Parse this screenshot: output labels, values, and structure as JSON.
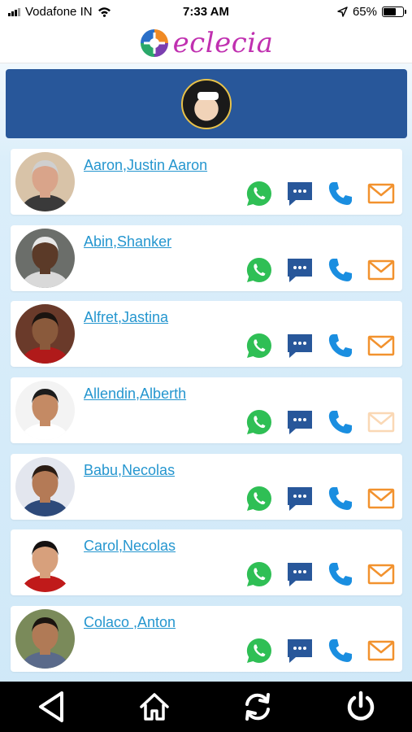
{
  "status_bar": {
    "carrier": "Vodafone IN",
    "time": "7:33 AM",
    "battery": "65%",
    "battery_level": 0.65
  },
  "app": {
    "logo_text": "eclecia",
    "brand_color": "#c030b0"
  },
  "banner": {
    "background": "#28579a"
  },
  "contacts": [
    {
      "name": "Aaron,Justin Aaron",
      "avatar_bg": "#d8c3a8",
      "skin": "#d9a48a",
      "hair": "#cfcfcf",
      "cloth": "#3a3a3a"
    },
    {
      "name": "Abin,Shanker",
      "avatar_bg": "#6b6e6a",
      "skin": "#5b3a28",
      "hair": "#e8e8e8",
      "cloth": "#d9d9d9"
    },
    {
      "name": "Alfret,Jastina",
      "avatar_bg": "#6a3a2a",
      "skin": "#8a5a3c",
      "hair": "#1b1410",
      "cloth": "#b01a1a"
    },
    {
      "name": "Allendin,Alberth",
      "avatar_bg": "#f3f3f3",
      "skin": "#c48a64",
      "hair": "#1c1c1c",
      "cloth": "#ffffff"
    },
    {
      "name": "Babu,Necolas",
      "avatar_bg": "#e3e6ee",
      "skin": "#b47a56",
      "hair": "#2a1c14",
      "cloth": "#2e4a7a"
    },
    {
      "name": "Carol,Necolas",
      "avatar_bg": "#ffffff",
      "skin": "#d7a07c",
      "hair": "#141010",
      "cloth": "#c01a1a"
    },
    {
      "name": "Colaco ,Anton",
      "avatar_bg": "#7a8a5a",
      "skin": "#b07a56",
      "hair": "#1a1410",
      "cloth": "#5a6a8a"
    }
  ],
  "actions": {
    "whatsapp_color": "#2fbf55",
    "message_color": "#28579a",
    "call_color": "#1a8ee0",
    "mail_color": "#f2922e"
  },
  "bottom_nav": [
    "back",
    "home",
    "refresh",
    "power"
  ]
}
